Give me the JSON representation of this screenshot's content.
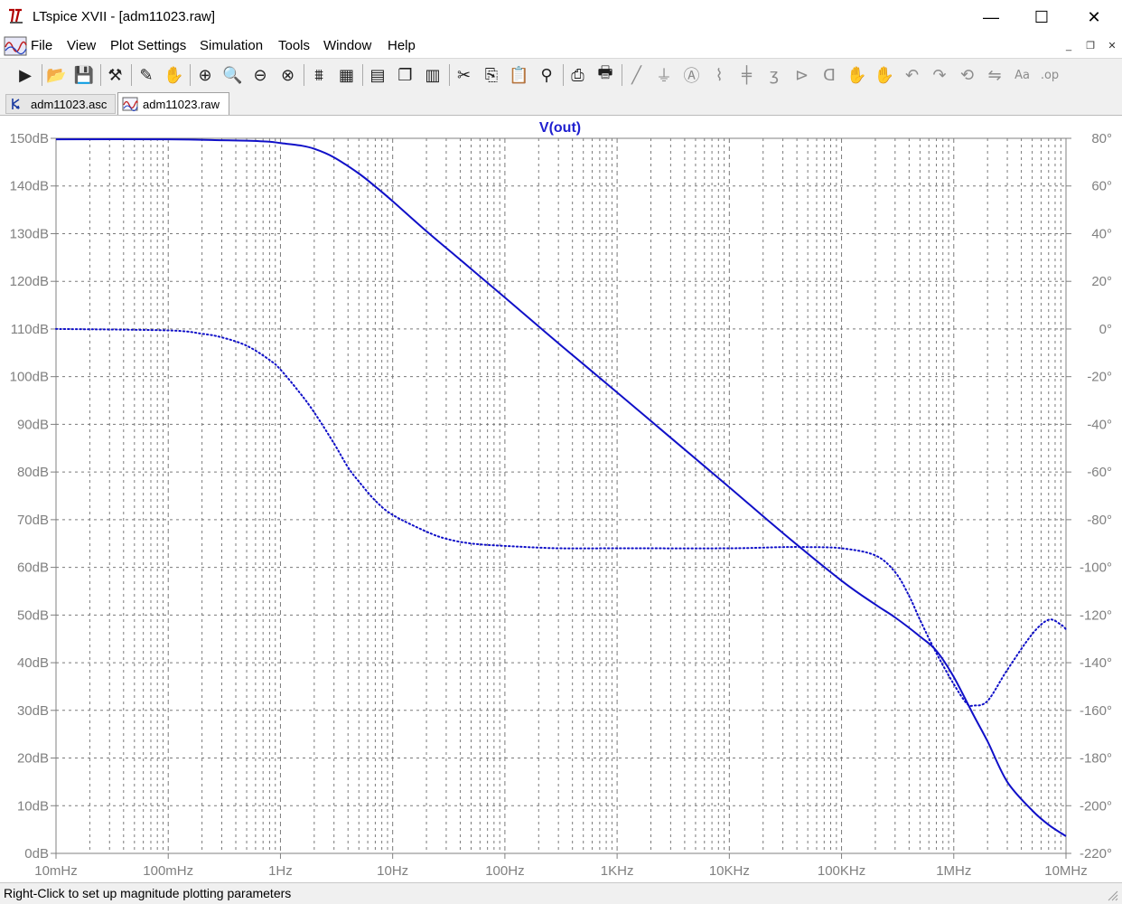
{
  "window": {
    "title": "LTspice XVII - [adm11023.raw]",
    "minimize_glyph": "—",
    "maximize_glyph": "☐",
    "close_glyph": "✕"
  },
  "menu": [
    {
      "label": "File"
    },
    {
      "label": "View"
    },
    {
      "label": "Plot Settings"
    },
    {
      "label": "Simulation"
    },
    {
      "label": "Tools"
    },
    {
      "label": "Window"
    },
    {
      "label": "Help"
    }
  ],
  "mdi": {
    "minimize": "_",
    "restore": "❐",
    "close": "✕"
  },
  "toolbar": [
    {
      "icon": "run-icon"
    },
    {
      "icon": "open-icon"
    },
    {
      "icon": "save-icon"
    },
    {
      "icon": "control-panel-icon"
    },
    {
      "icon": "probe-icon"
    },
    {
      "icon": "pan-hand-icon"
    },
    {
      "icon": "zoom-in-icon"
    },
    {
      "icon": "zoom-back-icon"
    },
    {
      "icon": "zoom-out-icon"
    },
    {
      "icon": "zoom-cancel-icon"
    },
    {
      "icon": "autorange-icon"
    },
    {
      "icon": "grid-icon"
    },
    {
      "icon": "tile-horizontal-icon"
    },
    {
      "icon": "cascade-icon"
    },
    {
      "icon": "tile-vertical-icon"
    },
    {
      "icon": "cut-icon"
    },
    {
      "icon": "copy-icon"
    },
    {
      "icon": "paste-icon"
    },
    {
      "icon": "find-icon"
    },
    {
      "icon": "print-preview-icon"
    },
    {
      "icon": "print-icon"
    },
    {
      "icon": "wire-icon"
    },
    {
      "icon": "ground-icon"
    },
    {
      "icon": "label-net-icon"
    },
    {
      "icon": "resistor-icon"
    },
    {
      "icon": "capacitor-icon"
    },
    {
      "icon": "inductor-icon"
    },
    {
      "icon": "diode-icon"
    },
    {
      "icon": "component-icon"
    },
    {
      "icon": "move-icon"
    },
    {
      "icon": "drag-icon"
    },
    {
      "icon": "undo-icon"
    },
    {
      "icon": "redo-icon"
    },
    {
      "icon": "rotate-icon"
    },
    {
      "icon": "mirror-icon"
    },
    {
      "icon": "text-icon"
    },
    {
      "icon": "spice-directive-icon"
    }
  ],
  "tabs": [
    {
      "label": "adm11023.asc",
      "icon": "schematic-icon",
      "active": false
    },
    {
      "label": "adm11023.raw",
      "icon": "waveform-icon",
      "active": true
    }
  ],
  "status": {
    "text": "Right-Click to set up magnitude plotting parameters"
  },
  "colors": {
    "trace": "#1010c8",
    "title": "#2020d0",
    "axis_label": "#808080",
    "grid": "#7a7a7a"
  },
  "chart_data": {
    "type": "line",
    "title": "V(out)",
    "x_scale": "log",
    "xlim": [
      0.01,
      10000000
    ],
    "x_ticks": [
      {
        "v": 0.01,
        "label": "10mHz"
      },
      {
        "v": 0.1,
        "label": "100mHz"
      },
      {
        "v": 1,
        "label": "1Hz"
      },
      {
        "v": 10,
        "label": "10Hz"
      },
      {
        "v": 100,
        "label": "100Hz"
      },
      {
        "v": 1000,
        "label": "1KHz"
      },
      {
        "v": 10000,
        "label": "10KHz"
      },
      {
        "v": 100000,
        "label": "100KHz"
      },
      {
        "v": 1000000,
        "label": "1MHz"
      },
      {
        "v": 10000000,
        "label": "10MHz"
      }
    ],
    "ylim_left": [
      0,
      150
    ],
    "y_left_ticks": [
      {
        "v": 150,
        "label": "150dB"
      },
      {
        "v": 140,
        "label": "140dB"
      },
      {
        "v": 130,
        "label": "130dB"
      },
      {
        "v": 120,
        "label": "120dB"
      },
      {
        "v": 110,
        "label": "110dB"
      },
      {
        "v": 100,
        "label": "100dB"
      },
      {
        "v": 90,
        "label": "90dB"
      },
      {
        "v": 80,
        "label": "80dB"
      },
      {
        "v": 70,
        "label": "70dB"
      },
      {
        "v": 60,
        "label": "60dB"
      },
      {
        "v": 50,
        "label": "50dB"
      },
      {
        "v": 40,
        "label": "40dB"
      },
      {
        "v": 30,
        "label": "30dB"
      },
      {
        "v": 20,
        "label": "20dB"
      },
      {
        "v": 10,
        "label": "10dB"
      },
      {
        "v": 0,
        "label": "0dB"
      }
    ],
    "ylim_right": [
      -220,
      80
    ],
    "y_right_ticks": [
      {
        "v": 80,
        "label": "80°"
      },
      {
        "v": 60,
        "label": "60°"
      },
      {
        "v": 40,
        "label": "40°"
      },
      {
        "v": 20,
        "label": "20°"
      },
      {
        "v": 0,
        "label": "0°"
      },
      {
        "v": -20,
        "label": "-20°"
      },
      {
        "v": -40,
        "label": "-40°"
      },
      {
        "v": -60,
        "label": "-60°"
      },
      {
        "v": -80,
        "label": "-80°"
      },
      {
        "v": -100,
        "label": "-100°"
      },
      {
        "v": -120,
        "label": "-120°"
      },
      {
        "v": -140,
        "label": "-140°"
      },
      {
        "v": -160,
        "label": "-160°"
      },
      {
        "v": -180,
        "label": "-180°"
      },
      {
        "v": -200,
        "label": "-200°"
      },
      {
        "v": -220,
        "label": "-220°"
      }
    ],
    "series": [
      {
        "name": "magnitude",
        "axis": "left",
        "style": "solid",
        "points": [
          [
            0.01,
            149.8
          ],
          [
            0.1,
            149.8
          ],
          [
            0.3,
            149.6
          ],
          [
            0.5,
            149.5
          ],
          [
            0.8,
            149.3
          ],
          [
            1,
            149.0
          ],
          [
            1.5,
            148.5
          ],
          [
            2,
            147.8
          ],
          [
            3,
            146.0
          ],
          [
            5,
            142.6
          ],
          [
            7,
            139.9
          ],
          [
            10,
            136.8
          ],
          [
            20,
            130.5
          ],
          [
            30,
            127.0
          ],
          [
            50,
            122.6
          ],
          [
            100,
            116.6
          ],
          [
            300,
            107.0
          ],
          [
            1000,
            96.7
          ],
          [
            3000,
            87.2
          ],
          [
            10000,
            76.8
          ],
          [
            30000,
            67.2
          ],
          [
            100000,
            57.2
          ],
          [
            200000,
            52.2
          ],
          [
            300000,
            49.5
          ],
          [
            500000,
            45.5
          ],
          [
            700000,
            42.5
          ],
          [
            1000000,
            37.0
          ],
          [
            1500000,
            29.0
          ],
          [
            2000000,
            23.5
          ],
          [
            3000000,
            15.0
          ],
          [
            5000000,
            9.0
          ],
          [
            7000000,
            6.0
          ],
          [
            10000000,
            3.6
          ]
        ]
      },
      {
        "name": "phase",
        "axis": "right",
        "style": "dotted",
        "points": [
          [
            0.01,
            0
          ],
          [
            0.1,
            -0.6
          ],
          [
            0.2,
            -2
          ],
          [
            0.3,
            -3.5
          ],
          [
            0.5,
            -7
          ],
          [
            0.8,
            -13
          ],
          [
            1,
            -17
          ],
          [
            1.5,
            -27
          ],
          [
            2,
            -35
          ],
          [
            3,
            -48
          ],
          [
            4,
            -58
          ],
          [
            5,
            -64
          ],
          [
            7,
            -72
          ],
          [
            10,
            -78
          ],
          [
            20,
            -85
          ],
          [
            30,
            -88
          ],
          [
            50,
            -90
          ],
          [
            100,
            -91
          ],
          [
            300,
            -92
          ],
          [
            1000,
            -92
          ],
          [
            10000,
            -92
          ],
          [
            30000,
            -91.5
          ],
          [
            50000,
            -91.5
          ],
          [
            100000,
            -92
          ],
          [
            200000,
            -95
          ],
          [
            300000,
            -102
          ],
          [
            400000,
            -112
          ],
          [
            500000,
            -122
          ],
          [
            700000,
            -136
          ],
          [
            1000000,
            -149
          ],
          [
            1300000,
            -157
          ],
          [
            1500000,
            -158
          ],
          [
            2000000,
            -156
          ],
          [
            3000000,
            -143
          ],
          [
            5000000,
            -128
          ],
          [
            7000000,
            -122
          ],
          [
            9000000,
            -124
          ],
          [
            10000000,
            -126
          ]
        ]
      }
    ]
  }
}
